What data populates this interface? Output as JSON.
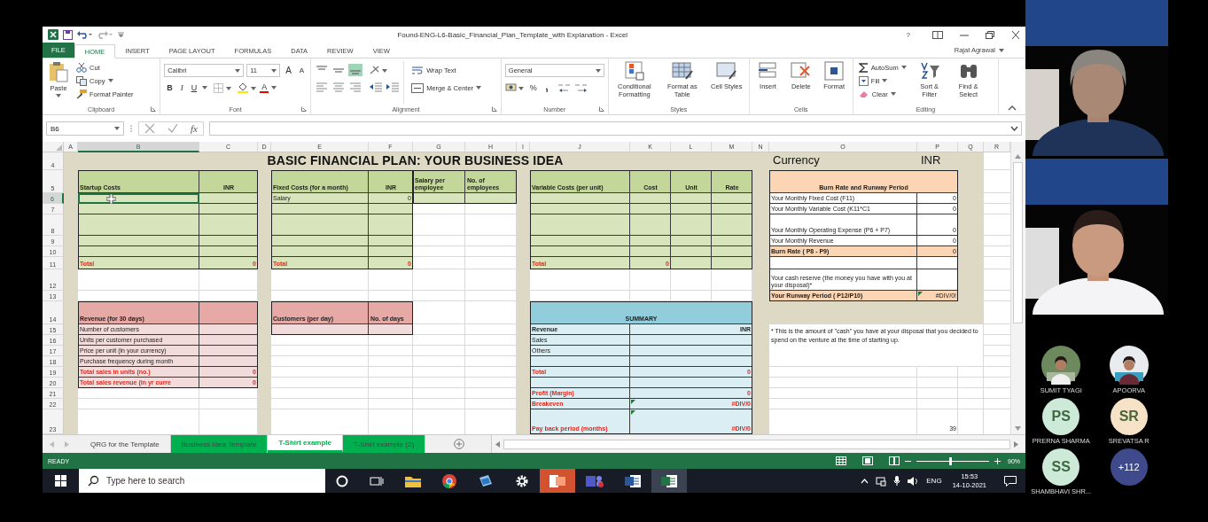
{
  "window": {
    "title": "Found-ENG-L6-Basic_Financial_Plan_Template_with Explanation - Excel",
    "help": "?",
    "user": "Rajat Agrawal"
  },
  "ribbon_tabs": [
    {
      "label": "FILE",
      "kind": "file",
      "selected": false
    },
    {
      "label": "HOME",
      "kind": "tab",
      "selected": true
    },
    {
      "label": "INSERT",
      "kind": "tab",
      "selected": false
    },
    {
      "label": "PAGE LAYOUT",
      "kind": "tab",
      "selected": false
    },
    {
      "label": "FORMULAS",
      "kind": "tab",
      "selected": false
    },
    {
      "label": "DATA",
      "kind": "tab",
      "selected": false
    },
    {
      "label": "REVIEW",
      "kind": "tab",
      "selected": false
    },
    {
      "label": "VIEW",
      "kind": "tab",
      "selected": false
    }
  ],
  "ribbon": {
    "clipboard": {
      "label": "Clipboard",
      "paste": "Paste",
      "cut": "Cut",
      "copy": "Copy",
      "format_painter": "Format Painter"
    },
    "font": {
      "label": "Font",
      "family": "Calibri",
      "size": "11",
      "grow": "A",
      "shrink": "A",
      "bold": "B",
      "italic": "I",
      "underline": "U",
      "font_color_button": "A"
    },
    "alignment": {
      "label": "Alignment",
      "wrap_text": "Wrap Text",
      "merge_center": "Merge & Center"
    },
    "number": {
      "label": "Number",
      "format": "General",
      "percent": "%"
    },
    "styles": {
      "label": "Styles",
      "conditional": "Conditional Formatting",
      "format_table": "Format as Table",
      "cell_styles": "Cell Styles"
    },
    "cells": {
      "label": "Cells",
      "insert": "Insert",
      "delete": "Delete",
      "format": "Format"
    },
    "editing": {
      "label": "Editing",
      "autosum": "AutoSum",
      "fill": "Fill",
      "clear": "Clear",
      "sort": "Sort & Filter",
      "find": "Find & Select"
    }
  },
  "formula_bar": {
    "name_box": "B6",
    "fx": "fx"
  },
  "sheet": {
    "columns": [
      {
        "label": "A",
        "selected": false
      },
      {
        "label": "B",
        "selected": true
      },
      {
        "label": "C",
        "selected": false
      },
      {
        "label": "D",
        "selected": false
      },
      {
        "label": "E",
        "selected": false
      },
      {
        "label": "F",
        "selected": false
      },
      {
        "label": "G",
        "selected": false
      },
      {
        "label": "H",
        "selected": false
      },
      {
        "label": "I",
        "selected": false
      },
      {
        "label": "J",
        "selected": false
      },
      {
        "label": "K",
        "selected": false
      },
      {
        "label": "L",
        "selected": false
      },
      {
        "label": "M",
        "selected": false
      },
      {
        "label": "N",
        "selected": false
      },
      {
        "label": "O",
        "selected": false
      },
      {
        "label": "P",
        "selected": false
      },
      {
        "label": "Q",
        "selected": false
      },
      {
        "label": "R",
        "selected": false
      }
    ],
    "rows": [
      {
        "label": "4",
        "selected": false
      },
      {
        "label": "5",
        "selected": false
      },
      {
        "label": "6",
        "selected": true
      },
      {
        "label": "7",
        "selected": false
      },
      {
        "label": "8",
        "selected": false
      },
      {
        "label": "9",
        "selected": false
      },
      {
        "label": "10",
        "selected": false
      },
      {
        "label": "11",
        "selected": false
      },
      {
        "label": "12",
        "selected": false
      },
      {
        "label": "13",
        "selected": false
      },
      {
        "label": "14",
        "selected": false
      },
      {
        "label": "15",
        "selected": false
      },
      {
        "label": "16",
        "selected": false
      },
      {
        "label": "17",
        "selected": false
      },
      {
        "label": "18",
        "selected": false
      },
      {
        "label": "19",
        "selected": false
      },
      {
        "label": "20",
        "selected": false
      },
      {
        "label": "21",
        "selected": false
      },
      {
        "label": "22",
        "selected": false
      },
      {
        "label": "23",
        "selected": false
      }
    ],
    "cells": [
      {
        "kind": "title",
        "text": "BASIC FINANCIAL PLAN: YOUR BUSINESS IDEA"
      },
      {
        "kind": "currency",
        "text": "Currency"
      },
      {
        "kind": "currency",
        "text": "INR"
      },
      {
        "kind": "heading",
        "text": "Startup Costs"
      },
      {
        "kind": "heading_center",
        "text": "INR"
      },
      {
        "kind": "heading",
        "text": "Fixed Costs (for a month)"
      },
      {
        "kind": "heading_center",
        "text": "INR"
      },
      {
        "kind": "heading",
        "text": "Salary per employee"
      },
      {
        "kind": "heading",
        "text": "No. of employees"
      },
      {
        "kind": "heading",
        "text": "Variable Costs (per unit)"
      },
      {
        "kind": "heading_center",
        "text": "Cost"
      },
      {
        "kind": "heading_center",
        "text": "Unit"
      },
      {
        "kind": "heading_center",
        "text": "Rate"
      },
      {
        "kind": "heading_center",
        "text": "Burn Rate and Runway Period"
      },
      {
        "kind": "text",
        "text": "Salary"
      },
      {
        "kind": "number",
        "text": "0"
      },
      {
        "kind": "text",
        "text": "Your Monthly Fixed Cost (F11)"
      },
      {
        "kind": "number",
        "text": "0"
      },
      {
        "kind": "text",
        "text": "Your Monthly Variable Cost (K11*C1"
      },
      {
        "kind": "number",
        "text": "0"
      },
      {
        "kind": "text",
        "text": "Your Monthly Operating Expense (P6 + P7)"
      },
      {
        "kind": "number",
        "text": "0"
      },
      {
        "kind": "text",
        "text": "Your Monthly Revenue"
      },
      {
        "kind": "number",
        "text": "0"
      },
      {
        "kind": "heading",
        "text": "Burn Rate ( P8 - P9)"
      },
      {
        "kind": "number",
        "text": "0"
      },
      {
        "kind": "total",
        "text": "Total"
      },
      {
        "kind": "total_number",
        "text": "0"
      },
      {
        "kind": "total",
        "text": "Total"
      },
      {
        "kind": "total_number",
        "text": "0"
      },
      {
        "kind": "total",
        "text": "Total"
      },
      {
        "kind": "total_number",
        "text": "0"
      },
      {
        "kind": "text",
        "text": "Your cash reserve (the money you have with you at your disposal)*"
      },
      {
        "kind": "heading",
        "text": "Your Runway Period ( P12/P10)"
      },
      {
        "kind": "number",
        "text": "#DIV/0!"
      },
      {
        "kind": "heading",
        "text": "Revenue (for 30 days)"
      },
      {
        "kind": "heading",
        "text": "Customers (per day)"
      },
      {
        "kind": "heading",
        "text": "No. of days"
      },
      {
        "kind": "heading_center",
        "text": "SUMMARY"
      },
      {
        "kind": "text",
        "text": "Number of customers"
      },
      {
        "kind": "heading",
        "text": "Revenue"
      },
      {
        "kind": "heading_right",
        "text": "INR"
      },
      {
        "kind": "text",
        "text": "Units per customer purchased"
      },
      {
        "kind": "text",
        "text": "Sales"
      },
      {
        "kind": "note",
        "text": "* This is the amount of \"cash\" you have at your disposal that you decided to spend on the venture at the time of starting up."
      },
      {
        "kind": "text",
        "text": "Price per unit (in your currency)"
      },
      {
        "kind": "text",
        "text": "Others"
      },
      {
        "kind": "text",
        "text": "Purchase frequency during month"
      },
      {
        "kind": "total",
        "text": "Total sales in units (no.)"
      },
      {
        "kind": "total_number",
        "text": "0"
      },
      {
        "kind": "total",
        "text": "Total"
      },
      {
        "kind": "total_number",
        "text": "0"
      },
      {
        "kind": "total",
        "text": "Total sales revenue (in yr curre"
      },
      {
        "kind": "total_number",
        "text": "0"
      },
      {
        "kind": "total",
        "text": "Profit (Margin)"
      },
      {
        "kind": "total_number",
        "text": "0"
      },
      {
        "kind": "total",
        "text": "Breakeven"
      },
      {
        "kind": "total_number",
        "text": "#DIV/0"
      },
      {
        "kind": "total",
        "text": "Pay back period (months)"
      },
      {
        "kind": "total_number",
        "text": "#DIV/0"
      },
      {
        "kind": "number",
        "text": "39"
      }
    ]
  },
  "sheet_tabs": [
    {
      "label": "QRG for the Template",
      "selected": false
    },
    {
      "label": "Business Idea Template",
      "selected": false,
      "color": "#00b050"
    },
    {
      "label": "T-Shirt example",
      "selected": true,
      "color": "#00b050"
    },
    {
      "label": "T-Shirt example (2)",
      "selected": false,
      "color": "#00b050"
    }
  ],
  "status_bar": {
    "mode": "READY",
    "zoom": "90%",
    "zoom_slider": {
      "level": 0.45
    }
  },
  "taskbar": {
    "search": {
      "placeholder": "Type here to search"
    },
    "language": "ENG",
    "time": "15:53",
    "date": "14-10-2021"
  },
  "meeting": {
    "participants": [
      {
        "name": "SUMIT TYAGI"
      },
      {
        "name": "APOORVA"
      },
      {
        "kind": "initials",
        "initials": "PS",
        "name": "PRERNA SHARMA",
        "color": "#cde9d8"
      },
      {
        "kind": "initials",
        "initials": "SR",
        "name": "SREVATSA R",
        "color": "#f6e2c6"
      },
      {
        "kind": "initials",
        "initials": "SS",
        "name": "SHAMBHAVI SHR...",
        "color": "#cde9d8"
      },
      {
        "kind": "more",
        "initials": "+112",
        "color": "#3e4a8c"
      }
    ]
  }
}
